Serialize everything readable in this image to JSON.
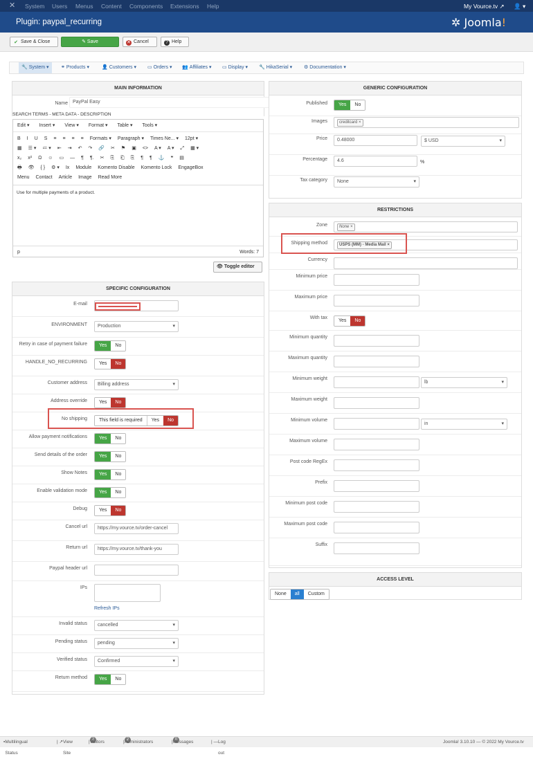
{
  "topnav": {
    "items": [
      "System",
      "Users",
      "Menus",
      "Content",
      "Components",
      "Extensions",
      "Help"
    ],
    "site": "My Vource.tv ↗",
    "user": "👤 ▾"
  },
  "title": "Plugin: paypal_recurring",
  "brand": {
    "a": "Joomla",
    "b": "!"
  },
  "toolbar": {
    "save_close": "Save & Close",
    "save": "Save",
    "cancel": "Cancel",
    "help": "Help"
  },
  "hnav": [
    "System",
    "Products",
    "Customers",
    "Orders",
    "Affiliates",
    "Display",
    "HikaSerial",
    "Documentation"
  ],
  "main": {
    "heading": "MAIN INFORMATION",
    "name_label": "Name",
    "name_value": "PayPal  Easy",
    "search_terms": "SEARCH TERMS - META DATA - DESCRIPTION"
  },
  "editor": {
    "menu": [
      "Edit ▾",
      "Insert ▾",
      "View ▾",
      "Format ▾",
      "Table ▾",
      "Tools ▾"
    ],
    "row1": [
      "B",
      "I",
      "U",
      "S",
      "≡",
      "≡",
      "≡",
      "≡",
      "Formats ▾",
      "Paragraph ▾",
      "Times Ne... ▾",
      "12pt ▾"
    ],
    "row2": [
      "▦",
      "☰ ▾",
      "≔ ▾",
      "⇤",
      "⇥",
      "↶",
      "↷",
      "🔗",
      "✂",
      "⚑",
      "▣",
      "<>",
      "A ▾",
      "A ▾",
      "⤢",
      "▦ ▾"
    ],
    "row3": [
      "x₂",
      "x²",
      "Ω",
      "☺",
      "▭",
      "—",
      "¶",
      "¶.",
      "✂",
      "⎘",
      "⎗",
      "⎘",
      "¶",
      "¶",
      "⚓",
      "❝",
      "▤"
    ],
    "row4": [
      "🖶",
      "👁",
      "{ }",
      "⚙ ▾",
      "Ix",
      "Module",
      "Komento Disable",
      "Komento Lock",
      "EngageBox"
    ],
    "row5": [
      "Menu",
      "Contact",
      "Article",
      "Image",
      "Read More"
    ],
    "content": "Use for multiple payments of a product.",
    "path": "p",
    "words": "Words: 7",
    "toggle": "Toggle editor"
  },
  "specific": {
    "heading": "SPECIFIC CONFIGURATION",
    "email_label": "E-mail",
    "env_label": "ENVIRONMENT",
    "env_value": "Production",
    "retry_label": "Retry in case of payment failure",
    "handle_label": "HANDLE_NO_RECURRING",
    "cust_addr_label": "Customer address",
    "cust_addr_value": "Billing address",
    "addr_override_label": "Address override",
    "no_ship_label": "No shipping",
    "no_ship_msg": "This field is required",
    "allow_notif_label": "Allow payment notifications",
    "send_details_label": "Send details of the order",
    "show_notes_label": "Show Notes",
    "enable_valid_label": "Enable validation mode",
    "debug_label": "Debug",
    "cancel_url_label": "Cancel url",
    "cancel_url_value": "https://my.vource.tv/order-cancel",
    "return_url_label": "Return url",
    "return_url_value": "https://my.vource.tv/thank-you",
    "header_url_label": "Paypal header url",
    "ips_label": "IPs",
    "refresh_ips": "Refresh IPs",
    "invalid_label": "Invalid status",
    "invalid_value": "cancelled",
    "pending_label": "Pending status",
    "pending_value": "pending",
    "verified_label": "Verified status",
    "verified_value": "Confirmed",
    "return_method_label": "Return method",
    "yes": "Yes",
    "no": "No"
  },
  "generic": {
    "heading": "GENERIC CONFIGURATION",
    "published_label": "Published",
    "images_label": "Images",
    "images_tag": "creditcard ×",
    "price_label": "Price",
    "price_value": "0.48000",
    "currency_value": "$ USD",
    "percentage_label": "Percentage",
    "percentage_value": "4.6",
    "percent_sign": "%",
    "tax_label": "Tax category",
    "tax_value": "None"
  },
  "restrictions": {
    "heading": "RESTRICTIONS",
    "zone_label": "Zone",
    "zone_tag": "None ×",
    "ship_label": "Shipping method",
    "ship_tag": "USPS (MM) - Media Mail ×",
    "currency_label": "Currency",
    "min_price": "Minimum price",
    "max_price": "Maximum price",
    "with_tax": "With tax",
    "min_qty": "Minimum quantity",
    "max_qty": "Maximum quantity",
    "min_weight": "Minimum weight",
    "weight_unit": "lb",
    "max_weight": "Maximum weight",
    "min_volume": "Minimum volume",
    "volume_unit": "in",
    "max_volume": "Maximum volume",
    "postcode_regex": "Post code RegEx",
    "prefix": "Prefix",
    "min_postcode": "Minimum post code",
    "max_postcode": "Maximum post code",
    "suffix": "Suffix"
  },
  "access": {
    "heading": "ACCESS LEVEL",
    "none": "None",
    "all": "all",
    "custom": "Custom"
  },
  "footer": {
    "multilingual": "Multilingual Status",
    "view_site": "View Site",
    "visitors_n": "2",
    "visitors": "Visitors",
    "admins_n": "2",
    "admins": "Administrators",
    "messages_n": "0",
    "messages": "Messages",
    "logout": "Log out",
    "version": "Joomla! 3.10.10 — © 2022 My Vource.tv"
  }
}
